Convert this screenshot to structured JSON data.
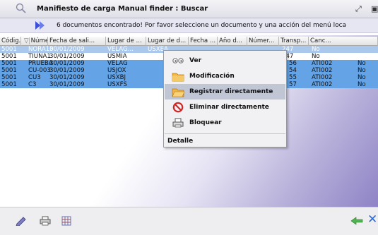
{
  "window": {
    "title": "Manifiesto de carga Manual finder : Buscar"
  },
  "info": {
    "message": "6 documentos encontrado! Por favor seleccione un documento y una acción del menú loca"
  },
  "table": {
    "columns": [
      "Códig...",
      "Número...",
      "Fecha de sali...",
      "Lugar de ...",
      "Lugar de d...",
      "Fecha ...",
      "Año d...",
      "Númer...",
      "Transp...",
      "Canc..."
    ],
    "rows": [
      [
        "5001",
        "NORA10",
        "30/01/2009",
        "VELAG...",
        "USXEA...",
        "",
        "",
        "",
        "247",
        "No"
      ],
      [
        "5001",
        "TIUNA1",
        "30/01/2009",
        "USMIA",
        "",
        "",
        "",
        "",
        "247",
        "No"
      ],
      [
        "5001",
        "PRUEBA",
        "30/01/2009",
        "VELAG",
        "",
        "",
        "",
        "56",
        "ATI002",
        "No"
      ],
      [
        "5001",
        "CU-003",
        "30/01/2009",
        "USJOX",
        "",
        "",
        "",
        "54",
        "ATI002",
        "No"
      ],
      [
        "5001",
        "CU3",
        "30/01/2009",
        "USXBJ",
        "",
        "",
        "",
        "55",
        "ATI002",
        "No"
      ],
      [
        "5001",
        "C3",
        "30/01/2009",
        "USXFS",
        "",
        "",
        "",
        "57",
        "ATI002",
        "No"
      ]
    ]
  },
  "menu": {
    "items": [
      {
        "label": "Ver",
        "icon": "eye-icon"
      },
      {
        "label": "Modificación",
        "icon": "folder-icon"
      },
      {
        "label": "Registrar directamente",
        "icon": "folder-open-icon"
      },
      {
        "label": "Eliminar directamente",
        "icon": "prohibited-icon"
      },
      {
        "label": "Bloquear",
        "icon": "printer-icon"
      }
    ],
    "detail_label": "Detalle"
  },
  "colors": {
    "selection": "#63a3e6",
    "selection_light": "#aac8ec",
    "menu_highlight": "#c0c6d4",
    "accent": "#4a6fd0"
  }
}
